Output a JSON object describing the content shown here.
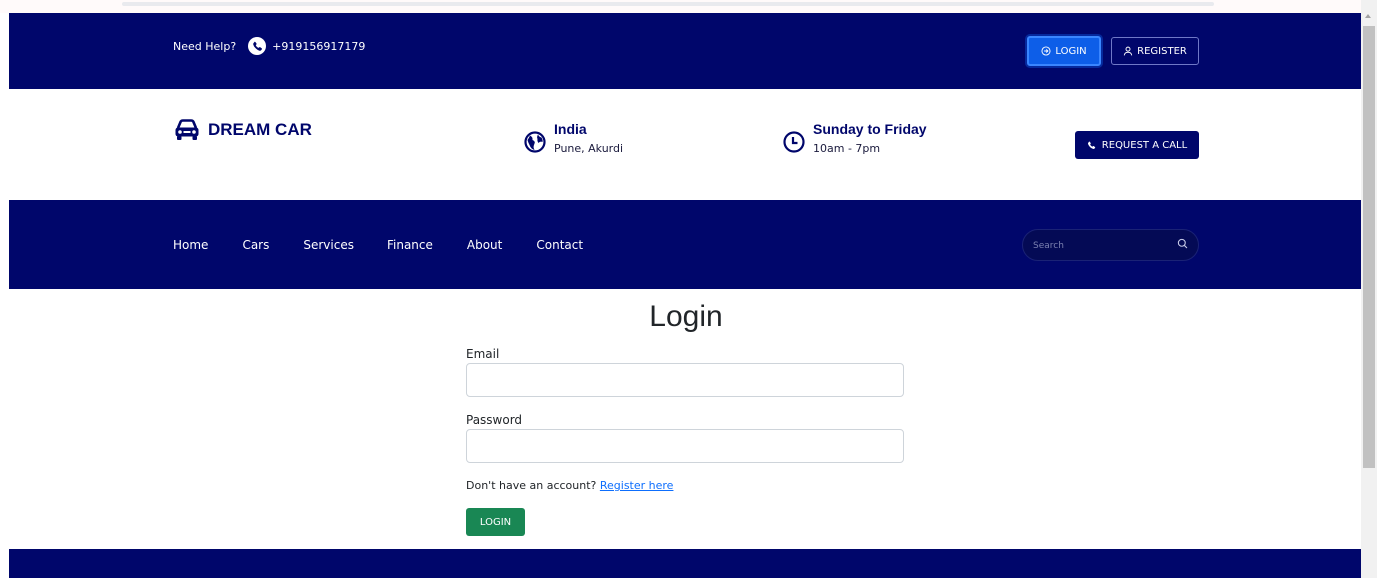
{
  "topbar": {
    "help_label": "Need Help?",
    "phone": "+919156917179",
    "login_label": "LOGIN",
    "register_label": "REGISTER"
  },
  "brand": {
    "name": "DREAM CAR",
    "color": "#00066b"
  },
  "location": {
    "title": "India",
    "subtitle": "Pune, Akurdi"
  },
  "hours": {
    "title": "Sunday to Friday",
    "subtitle": "10am - 7pm"
  },
  "request_call_label": "REQUEST A CALL",
  "nav": {
    "items": [
      {
        "label": "Home"
      },
      {
        "label": "Cars"
      },
      {
        "label": "Services"
      },
      {
        "label": "Finance"
      },
      {
        "label": "About"
      },
      {
        "label": "Contact"
      }
    ],
    "search_placeholder": "Search"
  },
  "form": {
    "title": "Login",
    "email_label": "Email",
    "email_value": "",
    "password_label": "Password",
    "password_value": "",
    "register_prompt": "Don't have an account?",
    "register_link": "Register here",
    "submit_label": "LOGIN"
  },
  "colors": {
    "primary": "#00066b",
    "accent_blue": "#0d6efd",
    "success": "#198754"
  }
}
